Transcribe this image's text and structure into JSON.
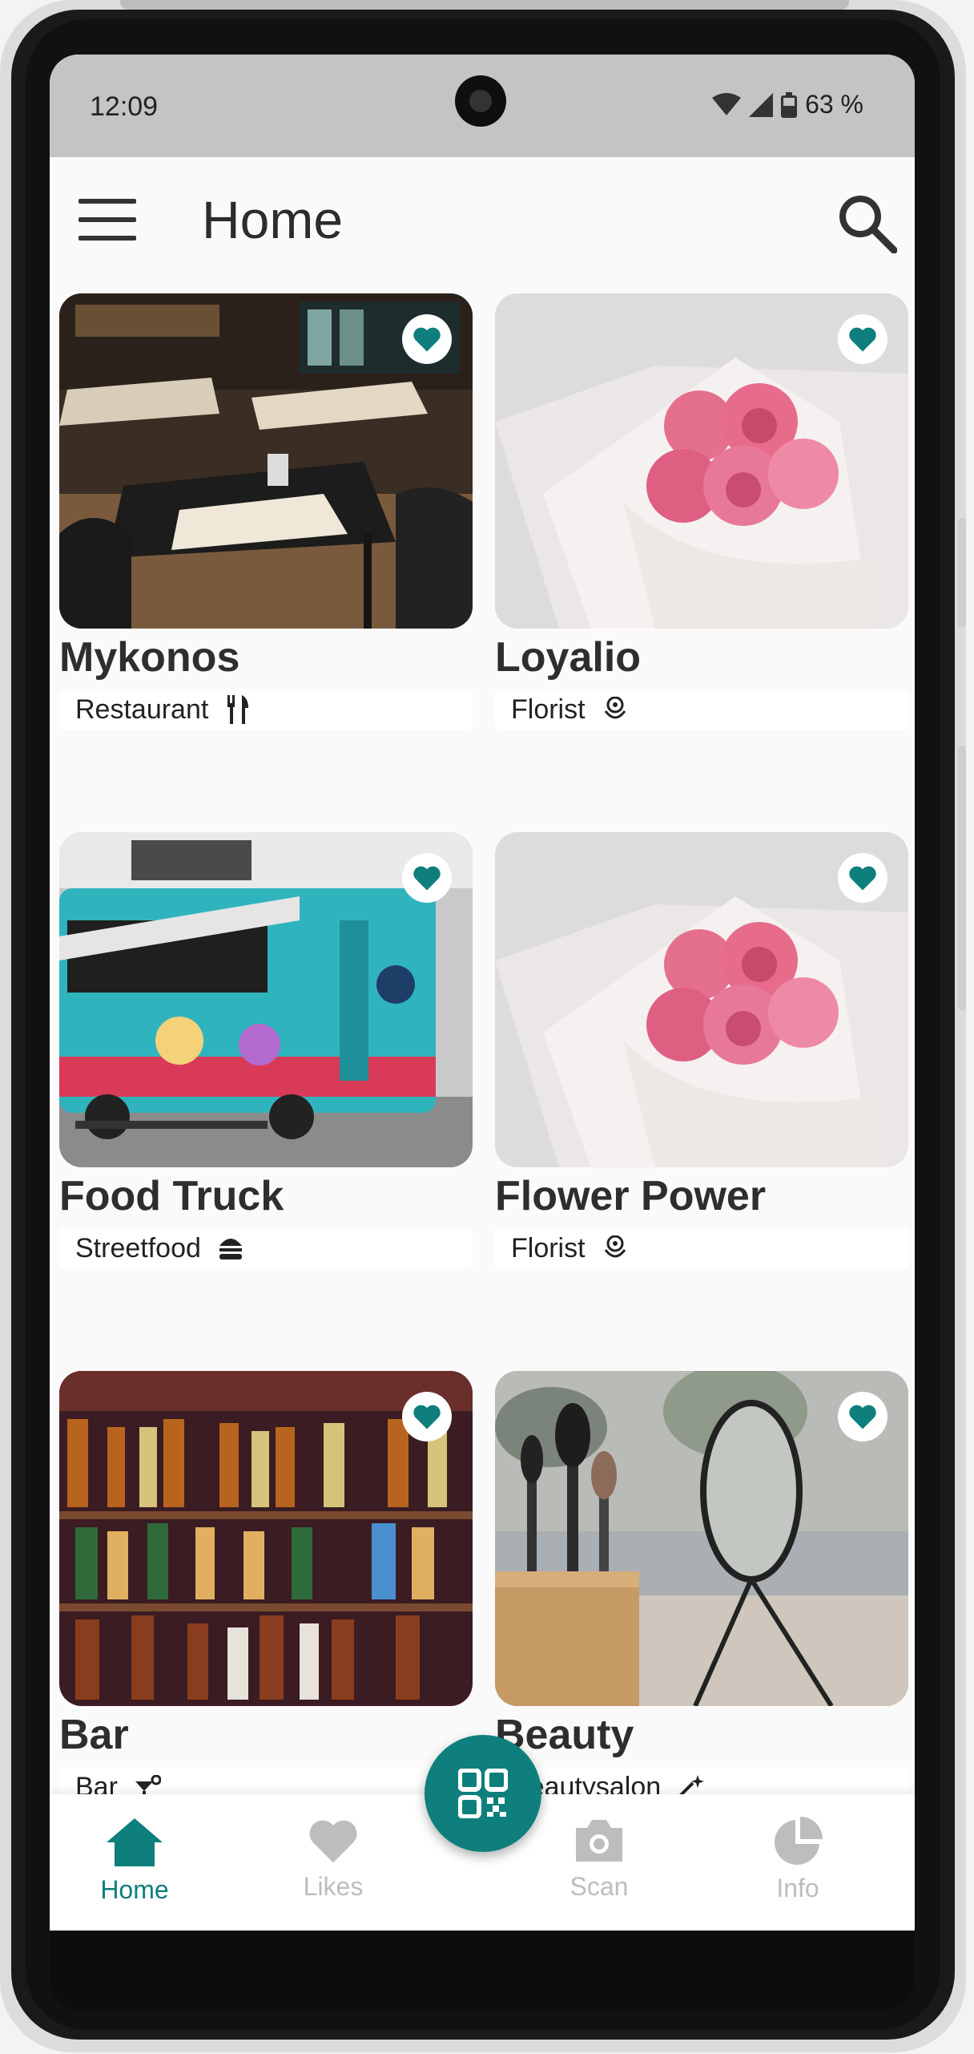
{
  "status_bar": {
    "time": "12:09",
    "battery": "63 %"
  },
  "app_bar": {
    "title": "Home"
  },
  "cards": [
    {
      "title": "Mykonos",
      "category": "Restaurant",
      "category_icon": "fork-knife-icon",
      "image": "restaurant-interior"
    },
    {
      "title": "Loyalio",
      "category": "Florist",
      "category_icon": "flower-icon",
      "image": "pink-peonies"
    },
    {
      "title": "Food Truck",
      "category": "Streetfood",
      "category_icon": "burger-icon",
      "image": "ice-cream-truck"
    },
    {
      "title": "Flower Power",
      "category": "Florist",
      "category_icon": "flower-icon",
      "image": "pink-peonies"
    },
    {
      "title": "Bar",
      "category": "Bar",
      "category_icon": "cocktail-icon",
      "image": "liquor-shelf"
    },
    {
      "title": "Beauty",
      "category": "Beautysalon",
      "category_icon": "sparkle-icon",
      "image": "makeup-brushes-mirror"
    }
  ],
  "bottom_nav": {
    "items": [
      {
        "label": "Home",
        "icon": "home-icon",
        "active": true
      },
      {
        "label": "Likes",
        "icon": "heart-icon",
        "active": false
      },
      {
        "label": "Scan",
        "icon": "camera-icon",
        "active": false
      },
      {
        "label": "Info",
        "icon": "pie-chart-icon",
        "active": false
      }
    ],
    "fab_icon": "qr-code-icon"
  },
  "colors": {
    "accent": "#0e7f7c",
    "inactive": "#b8b8b8",
    "background": "#fafafa"
  }
}
